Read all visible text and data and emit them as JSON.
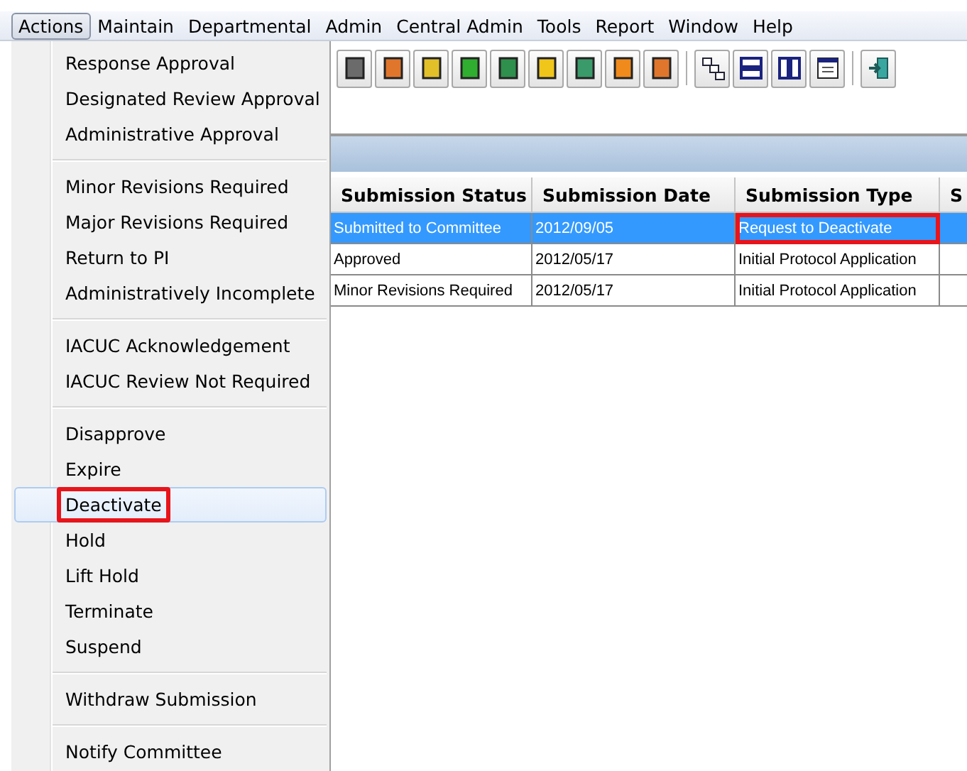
{
  "menubar": [
    {
      "label": "Actions",
      "selected": true
    },
    {
      "label": "Maintain",
      "selected": false
    },
    {
      "label": "Departmental",
      "selected": false
    },
    {
      "label": "Admin",
      "selected": false
    },
    {
      "label": "Central Admin",
      "selected": false
    },
    {
      "label": "Tools",
      "selected": false
    },
    {
      "label": "Report",
      "selected": false
    },
    {
      "label": "Window",
      "selected": false
    },
    {
      "label": "Help",
      "selected": false
    }
  ],
  "actions_menu": {
    "groups": [
      {
        "items": [
          {
            "label": "Response Approval",
            "selected": false,
            "annotated": false
          },
          {
            "label": "Designated Review Approval",
            "selected": false,
            "annotated": false
          },
          {
            "label": "Administrative Approval",
            "selected": false,
            "annotated": false
          }
        ]
      },
      {
        "items": [
          {
            "label": "Minor Revisions Required",
            "selected": false,
            "annotated": false
          },
          {
            "label": "Major Revisions Required",
            "selected": false,
            "annotated": false
          },
          {
            "label": "Return to PI",
            "selected": false,
            "annotated": false
          },
          {
            "label": "Administratively Incomplete",
            "selected": false,
            "annotated": false
          }
        ]
      },
      {
        "items": [
          {
            "label": "IACUC Acknowledgement",
            "selected": false,
            "annotated": false
          },
          {
            "label": "IACUC Review Not Required",
            "selected": false,
            "annotated": false
          }
        ]
      },
      {
        "items": [
          {
            "label": "Disapprove",
            "selected": false,
            "annotated": false
          },
          {
            "label": "Expire",
            "selected": false,
            "annotated": false
          },
          {
            "label": "Deactivate",
            "selected": true,
            "annotated": true
          },
          {
            "label": "Hold",
            "selected": false,
            "annotated": false
          },
          {
            "label": "Lift Hold",
            "selected": false,
            "annotated": false
          },
          {
            "label": "Terminate",
            "selected": false,
            "annotated": false
          },
          {
            "label": "Suspend",
            "selected": false,
            "annotated": false
          }
        ]
      },
      {
        "items": [
          {
            "label": "Withdraw Submission",
            "selected": false,
            "annotated": false
          }
        ]
      },
      {
        "items": [
          {
            "label": "Notify Committee",
            "selected": false,
            "annotated": false
          }
        ]
      }
    ]
  },
  "table": {
    "columns": [
      "Submission Status",
      "Submission Date",
      "Submission Type",
      "S"
    ],
    "rows": [
      {
        "selected": true,
        "cells": [
          {
            "text": "Submitted to Committee",
            "annotated": false
          },
          {
            "text": "2012/09/05",
            "annotated": false
          },
          {
            "text": "Request to Deactivate",
            "annotated": true
          },
          {
            "text": "",
            "annotated": false
          }
        ]
      },
      {
        "selected": false,
        "cells": [
          {
            "text": "Approved",
            "annotated": false
          },
          {
            "text": "2012/05/17",
            "annotated": false
          },
          {
            "text": "Initial Protocol Application",
            "annotated": false
          },
          {
            "text": "",
            "annotated": false
          }
        ]
      },
      {
        "selected": false,
        "cells": [
          {
            "text": "Minor Revisions Required",
            "annotated": false
          },
          {
            "text": "2012/05/17",
            "annotated": false
          },
          {
            "text": "Initial Protocol Application",
            "annotated": false
          },
          {
            "text": "",
            "annotated": false
          }
        ]
      }
    ]
  }
}
